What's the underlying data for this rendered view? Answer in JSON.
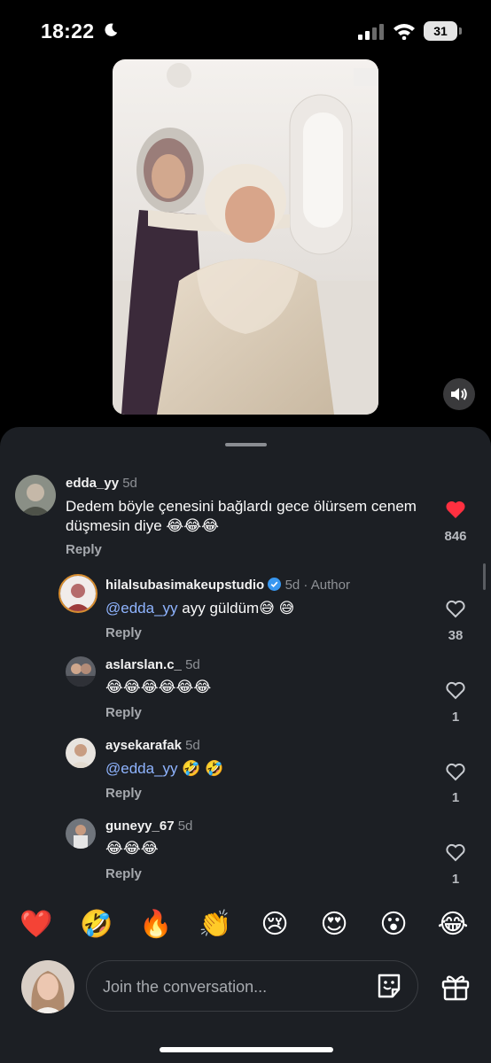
{
  "status_bar": {
    "time": "18:22",
    "battery": "31"
  },
  "comments": [
    {
      "username": "edda_yy",
      "age": "5d",
      "text": "Dedem böyle çenesini bağlardı gece ölürsem cenem düşmesin diye",
      "emojis": "😂😂😂",
      "reply": "Reply",
      "likes": "846",
      "liked": true
    },
    {
      "username": "hilalsubasimakeupstudio",
      "age": "5d",
      "author_tag": "Author",
      "mention": "@edda_yy",
      "text": "ayy güldüm",
      "emojis": "😅 😅",
      "reply": "Reply",
      "likes": "38"
    },
    {
      "username": "aslarslan.c_",
      "age": "5d",
      "emojis": "😂😂😂😂😂😂",
      "reply": "Reply",
      "likes": "1"
    },
    {
      "username": "aysekarafak",
      "age": "5d",
      "mention": "@edda_yy",
      "emojis": "🤣 🤣",
      "reply": "Reply",
      "likes": "1"
    },
    {
      "username": "guneyy_67",
      "age": "5d",
      "emojis": "😂😂😂",
      "reply": "Reply",
      "likes": "1"
    }
  ],
  "quick_reactions": [
    "❤️",
    "🤣",
    "🔥",
    "👏",
    "😢",
    "😍",
    "😮",
    "😂"
  ],
  "composer": {
    "placeholder": "Join the conversation..."
  },
  "colors": {
    "sheet_bg": "#1c1f24",
    "like_red": "#ff3040",
    "mention_blue": "#8fb4ff",
    "verified_blue": "#3897f0"
  },
  "icons": [
    "moon-icon",
    "cellular-signal-icon",
    "wifi-icon",
    "battery-icon",
    "speaker-icon",
    "heart-icon",
    "verified-badge-icon",
    "sticker-icon",
    "gift-icon"
  ]
}
